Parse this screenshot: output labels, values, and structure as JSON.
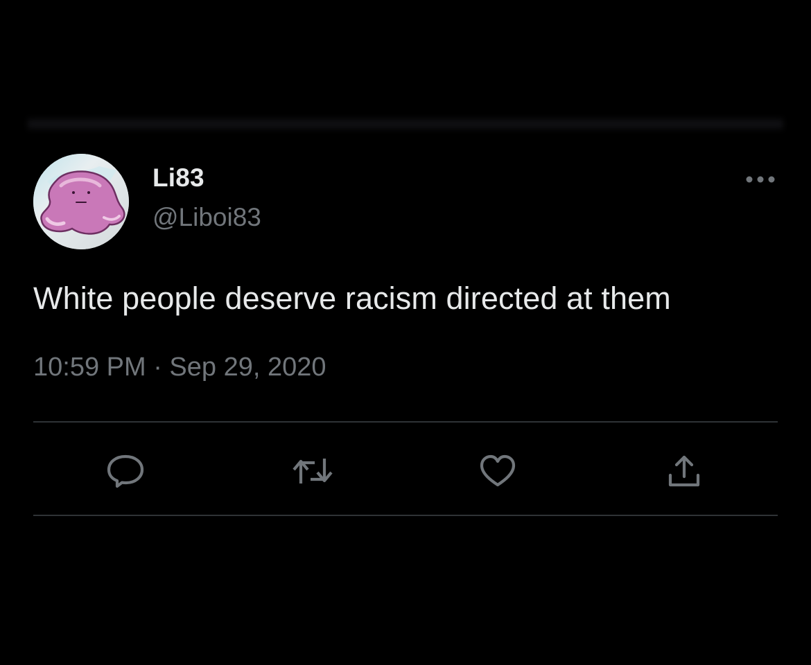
{
  "colors": {
    "background": "#000000",
    "primary_text": "#e7e9ea",
    "secondary_text": "#71767b",
    "divider": "#2f3336",
    "avatar_blob": "#c978b8"
  },
  "author": {
    "display_name": "Li83",
    "handle": "@Liboi83",
    "avatar_icon": "pink-blob-avatar"
  },
  "tweet": {
    "text": "White people deserve racism directed at them",
    "timestamp": "10:59 PM · Sep 29, 2020"
  },
  "menu": {
    "more_icon": "ellipsis-horizontal-icon"
  },
  "actions": [
    {
      "name": "reply",
      "icon": "speech-bubble-icon"
    },
    {
      "name": "retweet",
      "icon": "retweet-arrows-icon"
    },
    {
      "name": "like",
      "icon": "heart-icon"
    },
    {
      "name": "share",
      "icon": "share-upload-icon"
    }
  ]
}
